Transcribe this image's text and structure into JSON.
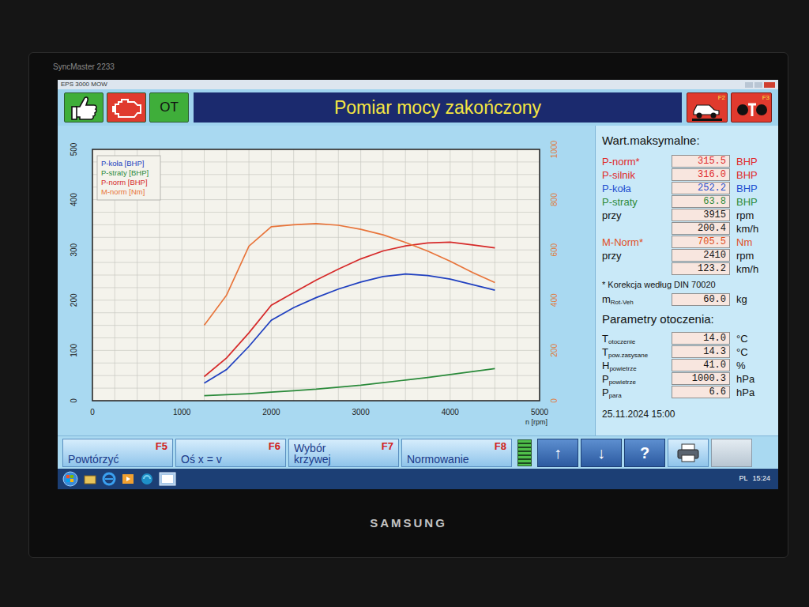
{
  "monitor": {
    "model": "SyncMaster 2233",
    "brand": "SAMSUNG"
  },
  "window": {
    "title": "EPS 3000 MOW"
  },
  "toolbar": {
    "left_buttons": [
      {
        "kind": "thumb",
        "color": "#3fae3a"
      },
      {
        "kind": "engine",
        "color": "#e03a2e"
      },
      {
        "kind": "text",
        "label": "OT",
        "color": "#3fae3a"
      }
    ],
    "status": "Pomiar mocy zakończony",
    "right_buttons": [
      {
        "kind": "car",
        "key": "F2",
        "color": "#e03a2e"
      },
      {
        "kind": "rollers",
        "key": "F3",
        "color": "#e03a2e"
      }
    ]
  },
  "chart": {
    "x_ticks": [
      "0",
      "1000",
      "2000",
      "3000",
      "4000",
      "5000"
    ],
    "x_label": "n [rpm]",
    "y_left_ticks": [
      "0",
      "100",
      "200",
      "300",
      "400",
      "500"
    ],
    "y_right_ticks": [
      "0",
      "200",
      "400",
      "600",
      "800",
      "1000"
    ],
    "rpm": [
      1250,
      1500,
      1750,
      2000,
      2250,
      2500,
      2750,
      3000,
      3250,
      3500,
      3750,
      4000,
      4250,
      4500
    ],
    "series": [
      {
        "legend": "P-koła [BHP]",
        "color": "#2040c0",
        "axis": "left",
        "values": [
          35,
          62,
          108,
          160,
          185,
          205,
          222,
          236,
          247,
          252,
          249,
          242,
          231,
          220
        ]
      },
      {
        "legend": "P-straty [BHP]",
        "color": "#2a8a3a",
        "axis": "left",
        "values": [
          10,
          12,
          14,
          17,
          20,
          23,
          27,
          31,
          36,
          41,
          46,
          52,
          58,
          63.8
        ]
      },
      {
        "legend": "P-norm [BHP]",
        "color": "#d62a2a",
        "axis": "left",
        "values": [
          48,
          85,
          135,
          190,
          215,
          240,
          262,
          282,
          298,
          308,
          314,
          315.5,
          310,
          304
        ]
      },
      {
        "legend": "M-norm [Nm]",
        "color": "#e8743a",
        "axis": "right",
        "values": [
          300,
          420,
          615,
          692,
          700,
          705,
          698,
          682,
          660,
          630,
          595,
          555,
          510,
          470
        ]
      }
    ]
  },
  "panel": {
    "max_title": "Wart.maksymalne:",
    "max_rows": [
      {
        "label": "P-norm*",
        "value": "315.5",
        "unit": "BHP",
        "color": "#e02a2a"
      },
      {
        "label": "P-silnik",
        "value": "316.0",
        "unit": "BHP",
        "color": "#e02a2a"
      },
      {
        "label": "P-koła",
        "value": "252.2",
        "unit": "BHP",
        "color": "#1f4fd0"
      },
      {
        "label": "P-straty",
        "value": "63.8",
        "unit": "BHP",
        "color": "#2e8b3a"
      },
      {
        "label": "przy",
        "value": "3915",
        "unit": "rpm",
        "color": "#111111"
      },
      {
        "label": "",
        "value": "200.4",
        "unit": "km/h",
        "color": "#111111"
      },
      {
        "label": "M-Norm*",
        "value": "705.5",
        "unit": "Nm",
        "color": "#e0501e"
      },
      {
        "label": "przy",
        "value": "2410",
        "unit": "rpm",
        "color": "#111111"
      },
      {
        "label": "",
        "value": "123.2",
        "unit": "km/h",
        "color": "#111111"
      }
    ],
    "note": "* Korekcja według DIN 70020",
    "mass_row": {
      "label": "m",
      "sub": "Rot-Veh",
      "value": "60.0",
      "unit": "kg"
    },
    "env_title": "Parametry otoczenia:",
    "env_rows": [
      {
        "label": "T",
        "sub": "otoczenie",
        "value": "14.0",
        "unit": "°C"
      },
      {
        "label": "T",
        "sub": "pow.zasysane",
        "value": "14.3",
        "unit": "°C"
      },
      {
        "label": "H",
        "sub": "powietrze",
        "value": "41.0",
        "unit": "%"
      },
      {
        "label": "P",
        "sub": "powietrze",
        "value": "1000.3",
        "unit": "hPa"
      },
      {
        "label": "P",
        "sub": "para",
        "value": "6.6",
        "unit": "hPa"
      }
    ],
    "date": "25.11.2024 15:00"
  },
  "function_keys": [
    {
      "label": "Powtórzyć",
      "key": "F5"
    },
    {
      "label": "Oś x = v",
      "key": "F6"
    },
    {
      "label": "Wybór krzywej",
      "key": "F7"
    },
    {
      "label": "Normowanie",
      "key": "F8"
    }
  ],
  "indicator": {
    "level": 1
  },
  "nav_buttons": [
    {
      "kind": "text",
      "label": "↑"
    },
    {
      "kind": "text",
      "label": "↓"
    },
    {
      "kind": "text",
      "label": "?"
    },
    {
      "kind": "printer"
    },
    {
      "kind": "blank"
    }
  ],
  "taskbar": {
    "language": "PL",
    "clock": "15:24"
  }
}
